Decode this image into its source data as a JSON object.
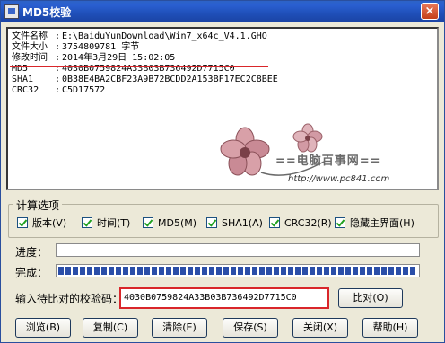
{
  "window": {
    "title": "MD5校验",
    "close_label": "×"
  },
  "output": {
    "rows": [
      {
        "label": "文件名称",
        "value": "E:\\BaiduYunDownload\\Win7_x64c_V4.1.GHO"
      },
      {
        "label": "文件大小",
        "value": "3754809781 字节"
      },
      {
        "label": "修改时间",
        "value": "2014年3月29日 15:02:05"
      },
      {
        "label": "MD5",
        "value": "4030B0759824A33B03B736492D7715C0"
      },
      {
        "label": "SHA1",
        "value": "0B38E4BA2CBF23A9B72BCDD2A153BF17EC2C8BEE"
      },
      {
        "label": "CRC32",
        "value": "C5D17572"
      }
    ],
    "separator": ":"
  },
  "watermark": {
    "brand": "==电脑百事网==",
    "url": "http://www.pc841.com"
  },
  "options": {
    "title": "计算选项",
    "checkboxes": [
      {
        "label": "版本(V)",
        "checked": true
      },
      {
        "label": "时间(T)",
        "checked": true
      },
      {
        "label": "MD5(M)",
        "checked": true
      },
      {
        "label": "SHA1(A)",
        "checked": true
      },
      {
        "label": "CRC32(R)",
        "checked": true
      },
      {
        "label": "隐藏主界面(H)",
        "checked": true
      }
    ]
  },
  "progress": {
    "label": "进度：",
    "value": 0
  },
  "complete": {
    "label": "完成：",
    "value": 1.0
  },
  "compare": {
    "label": "输入待比对的校验码：",
    "value": "4030B0759824A33B03B736492D7715C0",
    "button": "比对(O)"
  },
  "buttons": {
    "browse": "浏览(B)",
    "copy": "复制(C)",
    "clear": "清除(E)",
    "save": "保存(S)",
    "close": "关闭(X)",
    "help": "帮助(H)"
  },
  "colors": {
    "title_bar": "#2a5fd0",
    "highlight": "#d9262a",
    "progress_fill": "#2a4ea8"
  }
}
